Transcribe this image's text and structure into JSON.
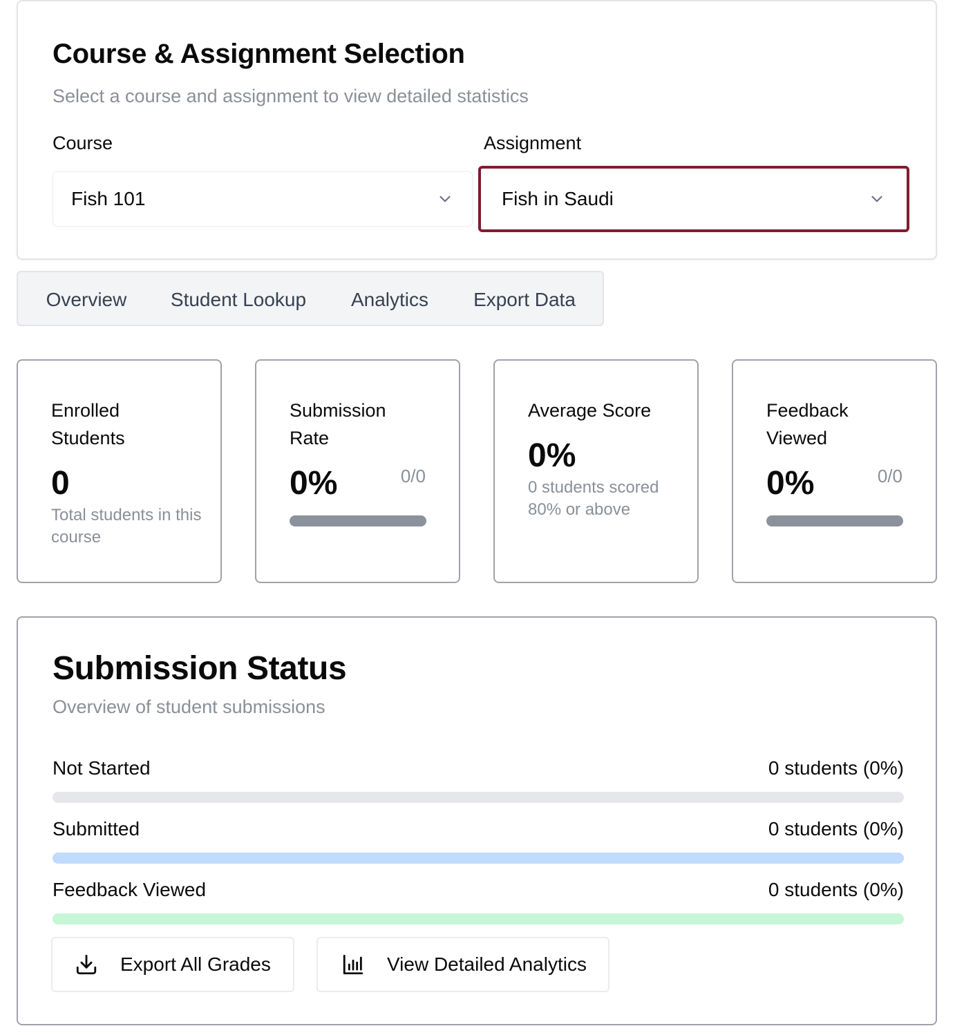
{
  "selection": {
    "title": "Course & Assignment Selection",
    "subtitle": "Select a course and assignment to view detailed statistics",
    "course_label": "Course",
    "course_value": "Fish 101",
    "assignment_label": "Assignment",
    "assignment_value": "Fish in Saudi",
    "focus_color": "#7f1d2d"
  },
  "tabs": [
    {
      "label": "Overview",
      "active": true
    },
    {
      "label": "Student Lookup",
      "active": false
    },
    {
      "label": "Analytics",
      "active": false
    },
    {
      "label": "Export Data",
      "active": false
    }
  ],
  "cards": {
    "enrolled": {
      "title": "Enrolled Students",
      "value": "0",
      "sub": "Total students in this course"
    },
    "submission_rate": {
      "title": "Submission Rate",
      "value": "0%",
      "ratio": "0/0",
      "progress": 0
    },
    "average_score": {
      "title": "Average Score",
      "value": "0%",
      "sub": "0 students scored 80% or above"
    },
    "feedback_viewed": {
      "title": "Feedback Viewed",
      "value": "0%",
      "ratio": "0/0",
      "progress": 0
    }
  },
  "status": {
    "title": "Submission Status",
    "subtitle": "Overview of student submissions",
    "rows": [
      {
        "label": "Not Started",
        "count": "0 students (0%)",
        "fraction": 0,
        "track_color": "#e5e7eb"
      },
      {
        "label": "Submitted",
        "count": "0 students (0%)",
        "fraction": 0,
        "track_color": "#bfdbfe"
      },
      {
        "label": "Feedback Viewed",
        "count": "0 students (0%)",
        "fraction": 0,
        "track_color": "#c6f6d5"
      }
    ],
    "export_label": "Export All Grades",
    "analytics_label": "View Detailed Analytics"
  }
}
